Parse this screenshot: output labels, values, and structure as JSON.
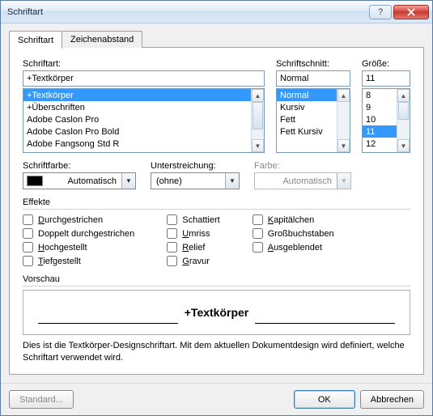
{
  "window": {
    "title": "Schriftart"
  },
  "tabs": {
    "font": "Schriftart",
    "spacing": "Zeichenabstand"
  },
  "labels": {
    "font": "Schriftart:",
    "style": "Schriftschnitt:",
    "size": "Größe:",
    "fontColor": "Schriftfarbe:",
    "underline": "Unterstreichung:",
    "ulColor": "Farbe:",
    "effects": "Effekte",
    "preview": "Vorschau"
  },
  "font": {
    "value": "+Textkörper",
    "list": [
      "+Textkörper",
      "+Überschriften",
      "Adobe Caslon Pro",
      "Adobe Caslon Pro Bold",
      "Adobe Fangsong Std R"
    ],
    "selectedIndex": 0
  },
  "style": {
    "value": "Normal",
    "list": [
      "Normal",
      "Kursiv",
      "Fett",
      "Fett Kursiv"
    ],
    "selectedIndex": 0
  },
  "size": {
    "value": "11",
    "list": [
      "8",
      "9",
      "10",
      "11",
      "12"
    ],
    "selectedIndex": 3
  },
  "fontColor": {
    "value": "Automatisch"
  },
  "underline": {
    "value": "(ohne)"
  },
  "ulColor": {
    "value": "Automatisch"
  },
  "effects": {
    "col1": [
      {
        "label": "Durchgestrichen",
        "ul": "D"
      },
      {
        "label": "Doppelt durchgestrichen",
        "ul": ""
      },
      {
        "label": "Hochgestellt",
        "ul": "H"
      },
      {
        "label": "Tiefgestellt",
        "ul": "T"
      }
    ],
    "col2": [
      {
        "label": "Schattiert",
        "ul": ""
      },
      {
        "label": "Umriss",
        "ul": "U"
      },
      {
        "label": "Relief",
        "ul": "R"
      },
      {
        "label": "Gravur",
        "ul": "G"
      }
    ],
    "col3": [
      {
        "label": "Kapitälchen",
        "ul": "K"
      },
      {
        "label": "Großbuchstaben",
        "ul": ""
      },
      {
        "label": "Ausgeblendet",
        "ul": "A"
      }
    ]
  },
  "preview": {
    "text": "+Textkörper"
  },
  "description": "Dies ist die Textkörper-Designschriftart. Mit dem aktuellen Dokumentdesign wird definiert, welche Schriftart verwendet wird.",
  "buttons": {
    "default": "Standard...",
    "ok": "OK",
    "cancel": "Abbrechen"
  }
}
